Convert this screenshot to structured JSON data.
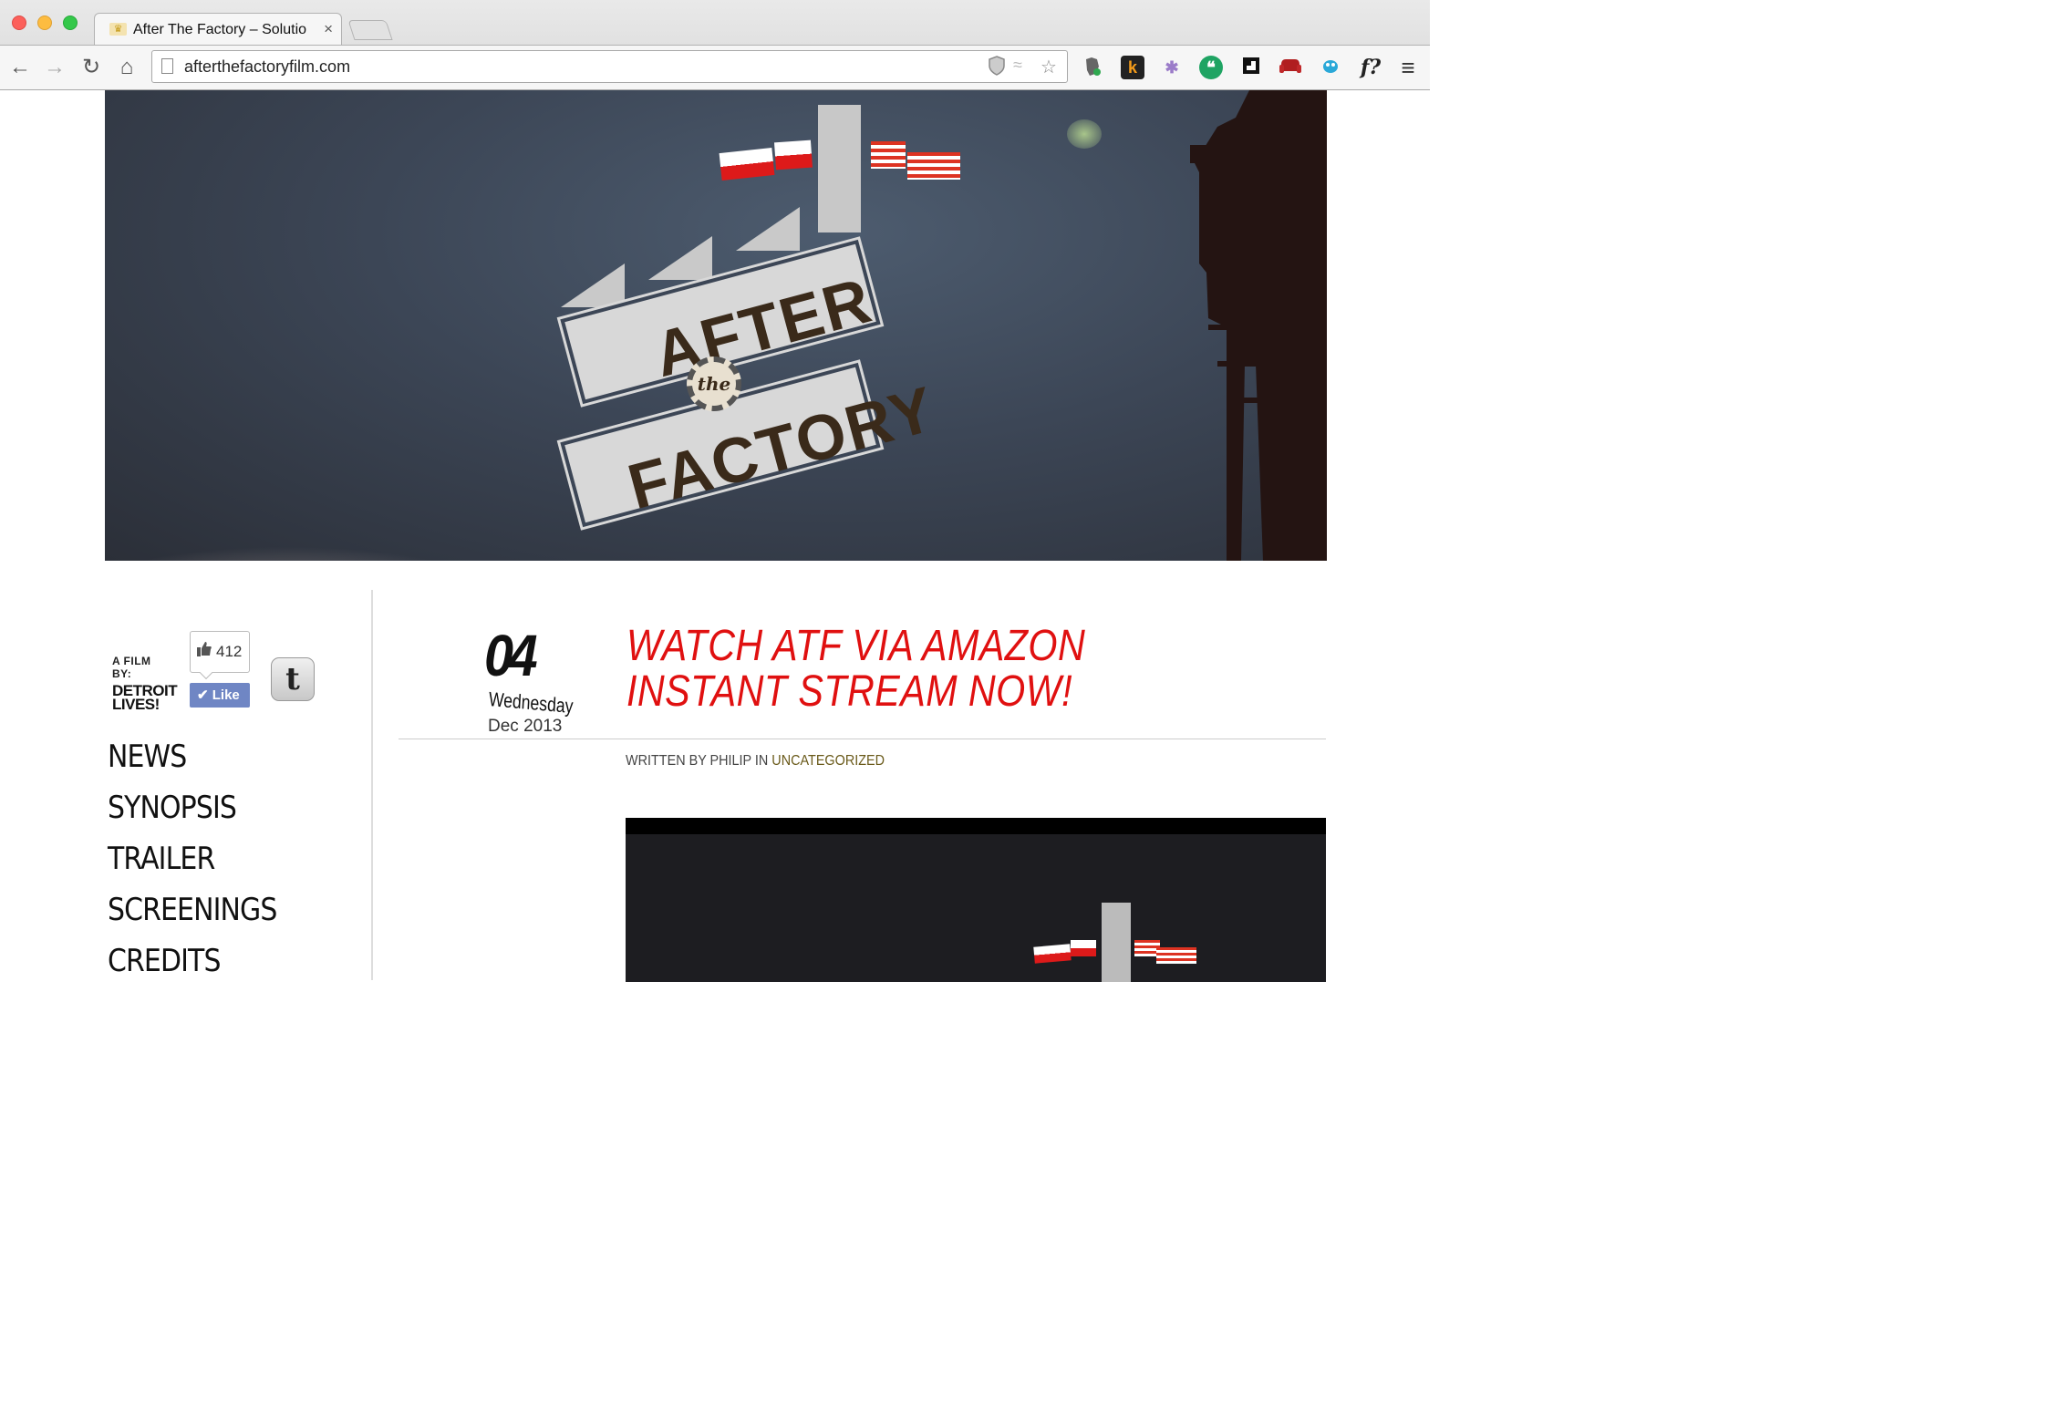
{
  "browser": {
    "tab_title": "After The Factory – Solutio",
    "tab_close": "×",
    "url": "afterthefactoryfilm.com",
    "nav_back": "←",
    "nav_forward": "→",
    "nav_reload": "↻",
    "nav_home": "⌂",
    "omni_icons": [
      "shield-icon",
      "handshake-icon",
      "star-icon"
    ],
    "extensions": [
      {
        "icon": "evernote-icon",
        "glyph": "●",
        "color": "#555555"
      },
      {
        "icon": "klout-icon",
        "glyph": "k",
        "color": "#f59c1a"
      },
      {
        "icon": "butterfly-icon",
        "glyph": "✱",
        "color": "#9b7cc9"
      },
      {
        "icon": "hangouts-icon",
        "glyph": "❝",
        "color": "#1fa463"
      },
      {
        "icon": "flipboard-icon",
        "glyph": "▣",
        "color": "#111111"
      },
      {
        "icon": "couch-icon",
        "glyph": "▬",
        "color": "#c0282a"
      },
      {
        "icon": "bug-icon",
        "glyph": "✦",
        "color": "#2aa8d8"
      },
      {
        "icon": "font-icon",
        "glyph": "f?",
        "color": "#222222"
      },
      {
        "icon": "menu-icon",
        "glyph": "≡",
        "color": "#333333"
      }
    ]
  },
  "hero": {
    "logo_top": "AFTER",
    "logo_mid": "the",
    "logo_bottom": "FACTORY"
  },
  "sidebar": {
    "credit_line1": "A FILM BY:",
    "credit_line2": "DETROIT LIVES!",
    "like_count": "412",
    "like_label": "Like",
    "twitter_glyph": "t",
    "nav": [
      "NEWS",
      "SYNOPSIS",
      "TRAILER",
      "SCREENINGS",
      "CREDITS"
    ]
  },
  "post": {
    "day": "04",
    "weekday": "Wednesday",
    "month_year": "Dec 2013",
    "title": "WATCH ATF VIA AMAZON INSTANT STREAM NOW!",
    "meta_prefix": "WRITTEN BY PHILIP IN ",
    "meta_category": "UNCATEGORIZED"
  },
  "colors": {
    "title_red": "#e01010",
    "fb_blue": "#6f86c4",
    "category_olive": "#6a5a1a"
  }
}
